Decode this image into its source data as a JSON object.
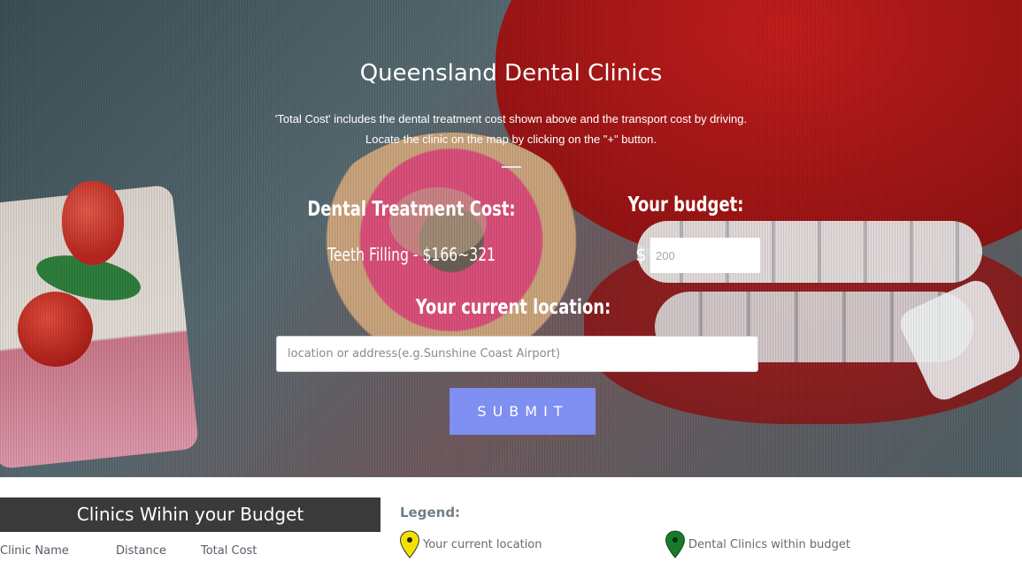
{
  "hero": {
    "title": "Queensland Dental Clinics",
    "description_line1": "'Total Cost' includes the dental treatment cost shown above and the transport cost by driving.",
    "description_line2": "Locate the clinic on the map by clicking on the \"+\" button."
  },
  "form": {
    "treatment_label": "Dental Treatment Cost:",
    "treatment_value": "Teeth Filling - $166~321",
    "budget_label": "Your budget:",
    "currency_symbol": "$",
    "budget_placeholder": "200",
    "location_label": "Your current location:",
    "location_placeholder": "location or address(e.g.Sunshine Coast Airport)",
    "submit_label": "SUBMIT"
  },
  "clinics": {
    "header": "Clinics Wihin your Budget",
    "columns": [
      "Clinic Name",
      "Distance",
      "Total Cost"
    ]
  },
  "legend": {
    "title": "Legend:",
    "items": [
      {
        "label": "Your current location",
        "icon": "yellow-map-pin-icon",
        "color": "#f5e100"
      },
      {
        "label": "Dental Clinics within budget",
        "icon": "green-map-pin-icon",
        "color": "#1a7a2a"
      }
    ]
  },
  "colors": {
    "submit_button": "#7f8ef1",
    "clinics_header_bg": "#3a3a3a",
    "legend_title": "#6f7f87"
  }
}
